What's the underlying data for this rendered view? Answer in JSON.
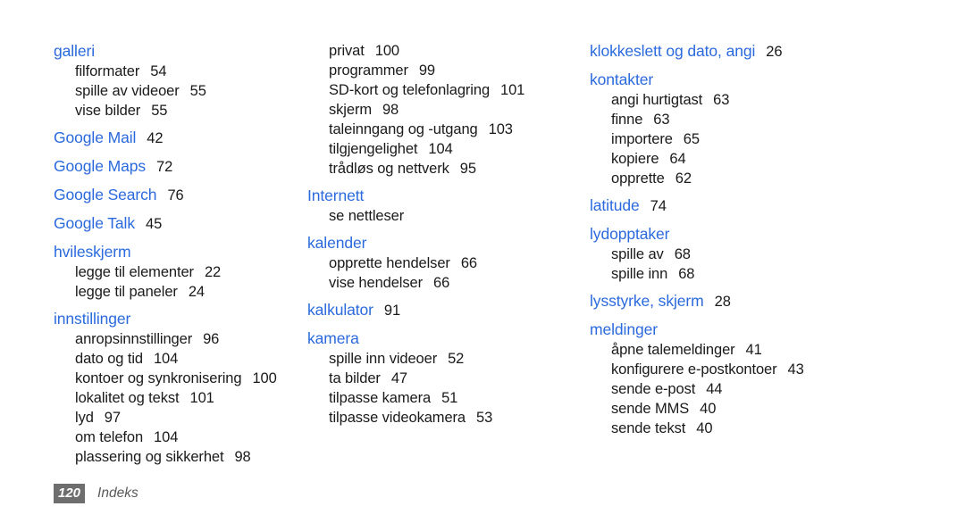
{
  "document": {
    "footer": {
      "page_number": "120",
      "section_label": "Indeks"
    },
    "accent_color": "#2a6ade",
    "columns": [
      {
        "id": "column-1",
        "groups": [
          {
            "heading": "galleri",
            "heading_page": "",
            "subentries": [
              {
                "label": "filformater",
                "page": "54"
              },
              {
                "label": "spille av videoer",
                "page": "55"
              },
              {
                "label": "vise bilder",
                "page": "55"
              }
            ]
          },
          {
            "heading": "Google Mail",
            "heading_page": "42",
            "subentries": []
          },
          {
            "heading": "Google Maps",
            "heading_page": "72",
            "subentries": []
          },
          {
            "heading": "Google Search",
            "heading_page": "76",
            "subentries": []
          },
          {
            "heading": "Google Talk",
            "heading_page": "45",
            "subentries": []
          },
          {
            "heading": "hvileskjerm",
            "heading_page": "",
            "subentries": [
              {
                "label": "legge til elementer",
                "page": "22"
              },
              {
                "label": "legge til paneler",
                "page": "24"
              }
            ]
          },
          {
            "heading": "innstillinger",
            "heading_page": "",
            "subentries": [
              {
                "label": "anropsinnstillinger",
                "page": "96"
              },
              {
                "label": "dato og tid",
                "page": "104"
              },
              {
                "label": "kontoer og synkronisering",
                "page": "100"
              },
              {
                "label": "lokalitet og tekst",
                "page": "101"
              },
              {
                "label": "lyd",
                "page": "97"
              },
              {
                "label": "om telefon",
                "page": "104"
              },
              {
                "label": "plassering og sikkerhet",
                "page": "98"
              }
            ]
          }
        ]
      },
      {
        "id": "column-2",
        "groups": [
          {
            "heading": "",
            "heading_page": "",
            "continuation": true,
            "subentries": [
              {
                "label": "privat",
                "page": "100"
              },
              {
                "label": "programmer",
                "page": "99"
              },
              {
                "label": "SD-kort og telefonlagring",
                "page": "101"
              },
              {
                "label": "skjerm",
                "page": "98"
              },
              {
                "label": "taleinngang og -utgang",
                "page": "103"
              },
              {
                "label": "tilgjengelighet",
                "page": "104"
              },
              {
                "label": "trådløs og nettverk",
                "page": "95"
              }
            ]
          },
          {
            "heading": "Internett",
            "heading_page": "",
            "subentries": [
              {
                "label": "se nettleser",
                "page": ""
              }
            ]
          },
          {
            "heading": "kalender",
            "heading_page": "",
            "subentries": [
              {
                "label": "opprette hendelser",
                "page": "66"
              },
              {
                "label": "vise hendelser",
                "page": "66"
              }
            ]
          },
          {
            "heading": "kalkulator",
            "heading_page": "91",
            "subentries": []
          },
          {
            "heading": "kamera",
            "heading_page": "",
            "subentries": [
              {
                "label": "spille inn videoer",
                "page": "52"
              },
              {
                "label": "ta bilder",
                "page": "47"
              },
              {
                "label": "tilpasse kamera",
                "page": "51"
              },
              {
                "label": "tilpasse videokamera",
                "page": "53"
              }
            ]
          }
        ]
      },
      {
        "id": "column-3",
        "groups": [
          {
            "heading": "klokkeslett og dato, angi",
            "heading_page": "26",
            "subentries": []
          },
          {
            "heading": "kontakter",
            "heading_page": "",
            "subentries": [
              {
                "label": "angi hurtigtast",
                "page": "63"
              },
              {
                "label": "finne",
                "page": "63"
              },
              {
                "label": "importere",
                "page": "65"
              },
              {
                "label": "kopiere",
                "page": "64"
              },
              {
                "label": "opprette",
                "page": "62"
              }
            ]
          },
          {
            "heading": "latitude",
            "heading_page": "74",
            "subentries": []
          },
          {
            "heading": "lydopptaker",
            "heading_page": "",
            "subentries": [
              {
                "label": "spille av",
                "page": "68"
              },
              {
                "label": "spille inn",
                "page": "68"
              }
            ]
          },
          {
            "heading": "lysstyrke, skjerm",
            "heading_page": "28",
            "subentries": []
          },
          {
            "heading": "meldinger",
            "heading_page": "",
            "subentries": [
              {
                "label": "åpne talemeldinger",
                "page": "41"
              },
              {
                "label": "konfigurere e-postkontoer",
                "page": "43"
              },
              {
                "label": "sende e-post",
                "page": "44"
              },
              {
                "label": "sende MMS",
                "page": "40"
              },
              {
                "label": "sende tekst",
                "page": "40"
              }
            ]
          }
        ]
      }
    ]
  }
}
